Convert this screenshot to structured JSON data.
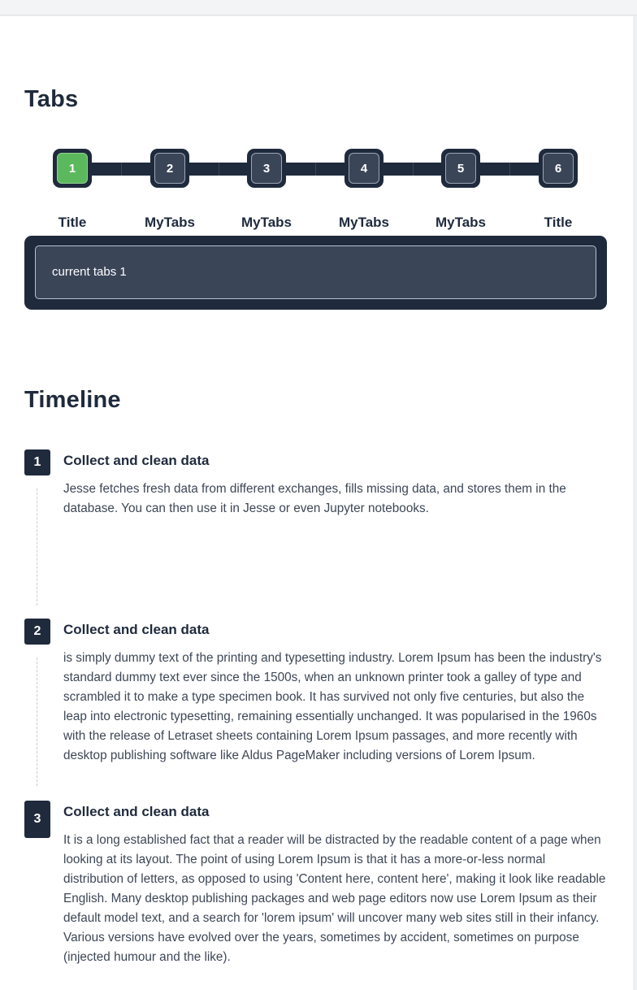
{
  "tabs_section": {
    "title": "Tabs",
    "steps": [
      {
        "number": "1",
        "label": "Title",
        "active": true
      },
      {
        "number": "2",
        "label": "MyTabs",
        "active": false
      },
      {
        "number": "3",
        "label": "MyTabs",
        "active": false
      },
      {
        "number": "4",
        "label": "MyTabs",
        "active": false
      },
      {
        "number": "5",
        "label": "MyTabs",
        "active": false
      },
      {
        "number": "6",
        "label": "Title",
        "active": false
      }
    ],
    "panel_text": "current tabs 1",
    "colors": {
      "active": "#5cb85c",
      "dark": "#1f2a3c",
      "inner": "#3a4558"
    }
  },
  "timeline_section": {
    "title": "Timeline",
    "items": [
      {
        "number": "1",
        "title": "Collect and clean data",
        "text": "Jesse fetches fresh data from different exchanges, fills missing data, and stores them in the database. You can then use it in Jesse or even Jupyter notebooks."
      },
      {
        "number": "2",
        "title": "Collect and clean data",
        "text": "is simply dummy text of the printing and typesetting industry. Lorem Ipsum has been the industry's standard dummy text ever since the 1500s, when an unknown printer took a galley of type and scrambled it to make a type specimen book. It has survived not only five centuries, but also the leap into electronic typesetting, remaining essentially unchanged. It was popularised in the 1960s with the release of Letraset sheets containing Lorem Ipsum passages, and more recently with desktop publishing software like Aldus PageMaker including versions of Lorem Ipsum."
      },
      {
        "number": "3",
        "title": "Collect and clean data",
        "text": "It is a long established fact that a reader will be distracted by the readable content of a page when looking at its layout. The point of using Lorem Ipsum is that it has a more-or-less normal distribution of letters, as opposed to using 'Content here, content here', making it look like readable English. Many desktop publishing packages and web page editors now use Lorem Ipsum as their default model text, and a search for 'lorem ipsum' will uncover many web sites still in their infancy. Various versions have evolved over the years, sometimes by accident, sometimes on purpose (injected humour and the like)."
      }
    ]
  }
}
